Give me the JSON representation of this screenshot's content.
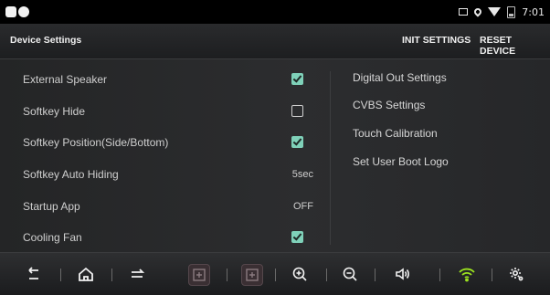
{
  "status_bar": {
    "time": "7:01",
    "icons": [
      "square-dot-icon",
      "circle-dot-icon",
      "cast-icon",
      "location-icon",
      "wifi-icon",
      "battery-icon"
    ]
  },
  "header": {
    "title": "Device Settings",
    "init_label": "INIT SETTINGS",
    "reset_label": "RESET DEVICE"
  },
  "settings": [
    {
      "label": "External Speaker",
      "control": "checkbox",
      "checked": true
    },
    {
      "label": "Softkey Hide",
      "control": "checkbox",
      "checked": false
    },
    {
      "label": "Softkey Position(Side/Bottom)",
      "control": "checkbox",
      "checked": true
    },
    {
      "label": "Softkey Auto Hiding",
      "control": "value",
      "value": "5sec"
    },
    {
      "label": "Startup App",
      "control": "value",
      "value": "OFF"
    },
    {
      "label": "Cooling Fan",
      "control": "checkbox",
      "checked": true
    }
  ],
  "links": [
    {
      "label": "Digital Out Settings"
    },
    {
      "label": "CVBS Settings"
    },
    {
      "label": "Touch Calibration"
    },
    {
      "label": "Set User Boot Logo"
    }
  ],
  "navbar": {
    "icons": [
      "back-icon",
      "home-icon",
      "switch-icon",
      "widget-icon",
      "widget-icon",
      "zoom-in-icon",
      "zoom-out-icon",
      "volume-icon",
      "wifi-icon",
      "settings-icon"
    ]
  },
  "colors": {
    "accent_check": "#7fd1b9",
    "wifi_green": "#9be21f"
  }
}
